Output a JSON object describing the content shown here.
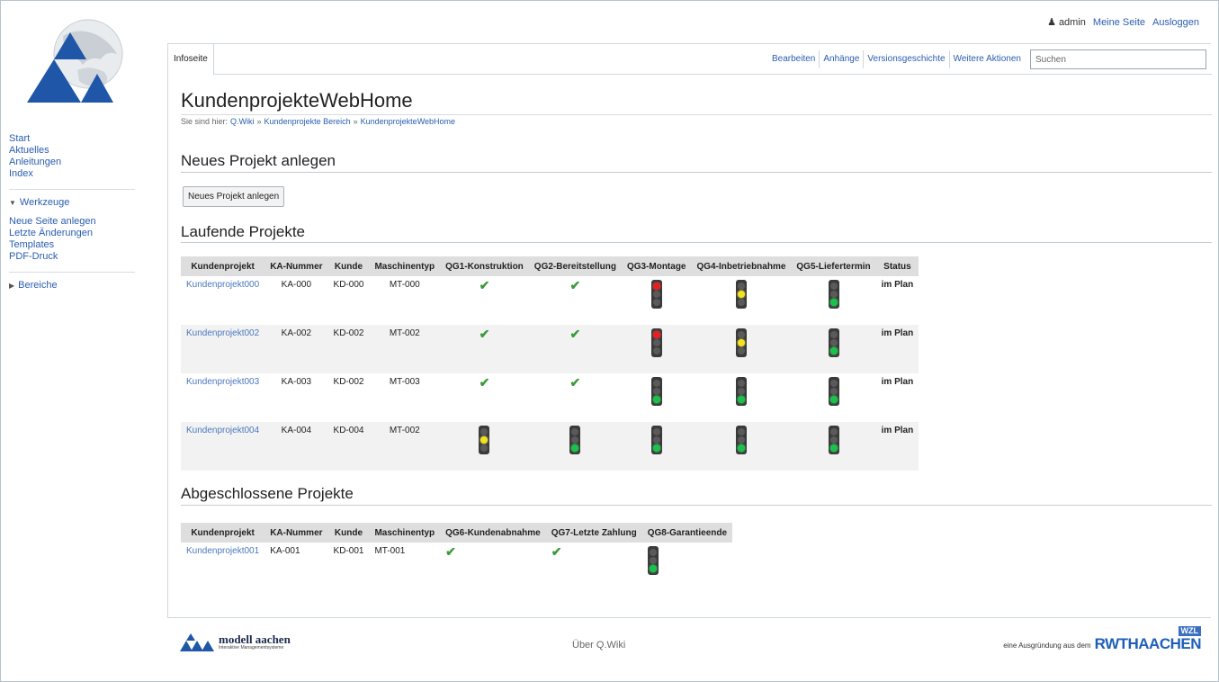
{
  "user": {
    "name": "admin",
    "links": [
      "Meine Seite",
      "Ausloggen"
    ]
  },
  "sidebar": {
    "nav": [
      "Start",
      "Aktuelles",
      "Anleitungen",
      "Index"
    ],
    "tools_title": "Werkzeuge",
    "tools": [
      "Neue Seite anlegen",
      "Letzte Änderungen",
      "Templates",
      "PDF-Druck"
    ],
    "areas_title": "Bereiche"
  },
  "tabs": {
    "info": "Infoseite"
  },
  "actions": [
    "Bearbeiten",
    "Anhänge",
    "Versionsgeschichte",
    "Weitere Aktionen"
  ],
  "search": {
    "placeholder": "Suchen"
  },
  "page": {
    "title": "KundenprojekteWebHome",
    "breadcrumb_prefix": "Sie sind hier:",
    "breadcrumb": [
      "Q.Wiki",
      "Kundenprojekte Bereich",
      "KundenprojekteWebHome"
    ],
    "breadcrumb_sep": "»"
  },
  "new_project": {
    "heading": "Neues Projekt anlegen",
    "button": "Neues Projekt anlegen"
  },
  "running": {
    "heading": "Laufende Projekte",
    "columns": [
      "Kundenprojekt",
      "KA-Nummer",
      "Kunde",
      "Maschinentyp",
      "QG1-Konstruktion",
      "QG2-Bereitstellung",
      "QG3-Montage",
      "QG4-Inbetriebnahme",
      "QG5-Liefertermin",
      "Status"
    ],
    "rows": [
      {
        "project": "Kundenprojekt000",
        "ka": "KA-000",
        "kunde": "KD-000",
        "typ": "MT-000",
        "qg1": "check",
        "qg2": "check",
        "qg3": "red",
        "qg4": "yellow",
        "qg5": "green",
        "status": "im Plan"
      },
      {
        "project": "Kundenprojekt002",
        "ka": "KA-002",
        "kunde": "KD-002",
        "typ": "MT-002",
        "qg1": "check",
        "qg2": "check",
        "qg3": "red",
        "qg4": "yellow",
        "qg5": "green",
        "status": "im Plan"
      },
      {
        "project": "Kundenprojekt003",
        "ka": "KA-003",
        "kunde": "KD-002",
        "typ": "MT-003",
        "qg1": "check",
        "qg2": "check",
        "qg3": "green",
        "qg4": "green",
        "qg5": "green",
        "status": "im Plan"
      },
      {
        "project": "Kundenprojekt004",
        "ka": "KA-004",
        "kunde": "KD-004",
        "typ": "MT-002",
        "qg1": "yellow",
        "qg2": "green",
        "qg3": "green",
        "qg4": "green",
        "qg5": "green",
        "status": "im Plan"
      }
    ]
  },
  "finished": {
    "heading": "Abgeschlossene Projekte",
    "columns": [
      "Kundenprojekt",
      "KA-Nummer",
      "Kunde",
      "Maschinentyp",
      "QG6-Kundenabnahme",
      "QG7-Letzte Zahlung",
      "QG8-Garantieende"
    ],
    "rows": [
      {
        "project": "Kundenprojekt001",
        "ka": "KA-001",
        "kunde": "KD-001",
        "typ": "MT-001",
        "qg6": "check",
        "qg7": "check",
        "qg8": "green"
      }
    ]
  },
  "footer": {
    "logo_name": "modell aachen",
    "logo_sub": "Interaktive Managementsysteme",
    "center": "Über Q.Wiki",
    "right_text": "eine Ausgründung aus dem",
    "wzl": "WZL",
    "rwth": "RWTHAACHEN"
  },
  "colors": {
    "link": "#2a5db0",
    "check": "#3c9a3a",
    "red": "#e62020",
    "yellow": "#f4e21c",
    "green": "#19c24a"
  }
}
